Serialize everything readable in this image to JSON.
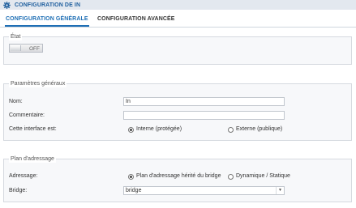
{
  "window": {
    "title": "CONFIGURATION DE IN"
  },
  "tabs": [
    {
      "label": "CONFIGURATION GÉNÉRALE",
      "active": true
    },
    {
      "label": "CONFIGURATION AVANCÉE",
      "active": false
    }
  ],
  "etat": {
    "legend": "État",
    "toggle_label": "OFF",
    "toggle_on": false
  },
  "general": {
    "legend": "Paramètres généraux",
    "name_label": "Nom:",
    "name_value": "In",
    "comment_label": "Commentaire:",
    "comment_value": "",
    "interface_label": "Cette interface est:",
    "option_internal": "Interne (protégée)",
    "option_external": "Externe (publique)",
    "selected": "internal"
  },
  "addressing": {
    "legend": "Plan d'adressage",
    "addressing_label": "Adressage:",
    "option_bridge": "Plan d'adressage hérité du bridge",
    "option_dynamic": "Dynamique / Statique",
    "selected": "bridge",
    "bridge_label": "Bridge:",
    "bridge_value": "bridge"
  },
  "colors": {
    "accent": "#1f6fb5",
    "title_bar": "#e3e8ef",
    "panel_bg": "#f7f8fa"
  },
  "icons": {
    "title": "gear-icon",
    "select_caret": "chevron-down-icon"
  }
}
